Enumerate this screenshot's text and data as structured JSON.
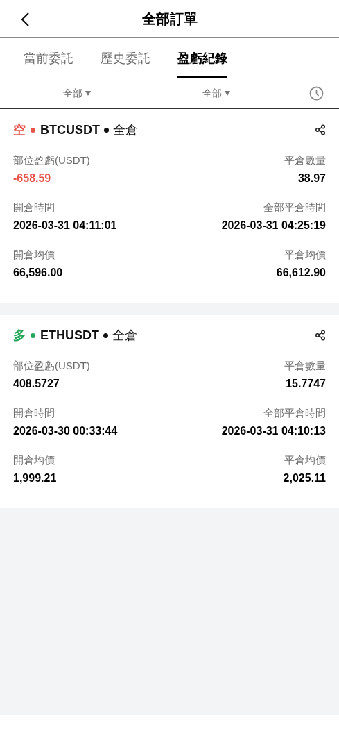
{
  "header": {
    "title": "全部訂單"
  },
  "tabs": [
    {
      "label": "當前委託",
      "selected": false
    },
    {
      "label": "歷史委託",
      "selected": false
    },
    {
      "label": "盈虧紀錄",
      "selected": true
    }
  ],
  "filters": [
    {
      "label": "全部"
    },
    {
      "label": "全部"
    }
  ],
  "orders": [
    {
      "side": "空",
      "color": "#e5534b",
      "symbol": "BTCUSDT",
      "margin_mode": "全倉",
      "fields": [
        {
          "label": "部位盈虧(USDT)",
          "value": "-658.59",
          "kind": "negative"
        },
        {
          "label": "平倉數量",
          "value": "38.97",
          "kind": "plain"
        },
        {
          "label": "開倉時間",
          "value": "2026-03-31 04:11:01",
          "kind": "plain"
        },
        {
          "label": "全部平倉時間",
          "value": "2026-03-31 04:25:19",
          "kind": "plain"
        },
        {
          "label": "開倉均價",
          "value": "66,596.00",
          "kind": "plain"
        },
        {
          "label": "平倉均價",
          "value": "66,612.90",
          "kind": "plain"
        }
      ]
    },
    {
      "side": "多",
      "color": "#26a65b",
      "symbol": "ETHUSDT",
      "margin_mode": "全倉",
      "fields": [
        {
          "label": "部位盈虧(USDT)",
          "value": "408.5727",
          "kind": "plain"
        },
        {
          "label": "平倉數量",
          "value": "15.7747",
          "kind": "plain"
        },
        {
          "label": "開倉時間",
          "value": "2026-03-30 00:33:44",
          "kind": "plain"
        },
        {
          "label": "全部平倉時間",
          "value": "2026-03-31 04:10:13",
          "kind": "plain"
        },
        {
          "label": "開倉均價",
          "value": "1,999.21",
          "kind": "plain"
        },
        {
          "label": "平倉均價",
          "value": "2,025.11",
          "kind": "plain"
        }
      ]
    }
  ]
}
